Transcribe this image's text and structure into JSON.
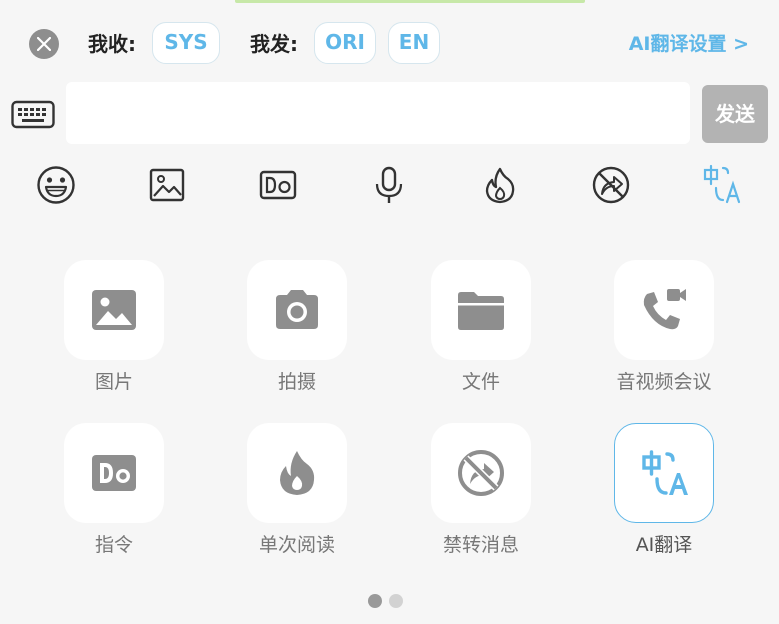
{
  "translation_bar": {
    "receive_label": "我收:",
    "receive_lang": "SYS",
    "send_label": "我发:",
    "send_lang_1": "ORI",
    "send_lang_2": "EN",
    "settings_link": "AI翻译设置 >"
  },
  "composer": {
    "input_value": "",
    "input_placeholder": "",
    "send_label": "发送"
  },
  "toolbar_icons": [
    "emoji-icon",
    "image-icon",
    "command-icon",
    "microphone-icon",
    "burn-after-read-icon",
    "no-forward-icon",
    "translate-icon"
  ],
  "panel": {
    "items": [
      {
        "label": "图片",
        "icon": "image-icon"
      },
      {
        "label": "拍摄",
        "icon": "camera-icon"
      },
      {
        "label": "文件",
        "icon": "folder-icon"
      },
      {
        "label": "音视频会议",
        "icon": "video-call-icon"
      },
      {
        "label": "指令",
        "icon": "command-icon"
      },
      {
        "label": "单次阅读",
        "icon": "fire-icon"
      },
      {
        "label": "禁转消息",
        "icon": "no-forward-icon"
      },
      {
        "label": "AI翻译",
        "icon": "translate-icon"
      }
    ],
    "page_count": 2,
    "current_page": 1
  },
  "colors": {
    "accent": "#5fb7e8",
    "tile_icon": "#8e8e8e",
    "send_disabled": "#b3b3b3",
    "background": "#f6f6f6"
  }
}
